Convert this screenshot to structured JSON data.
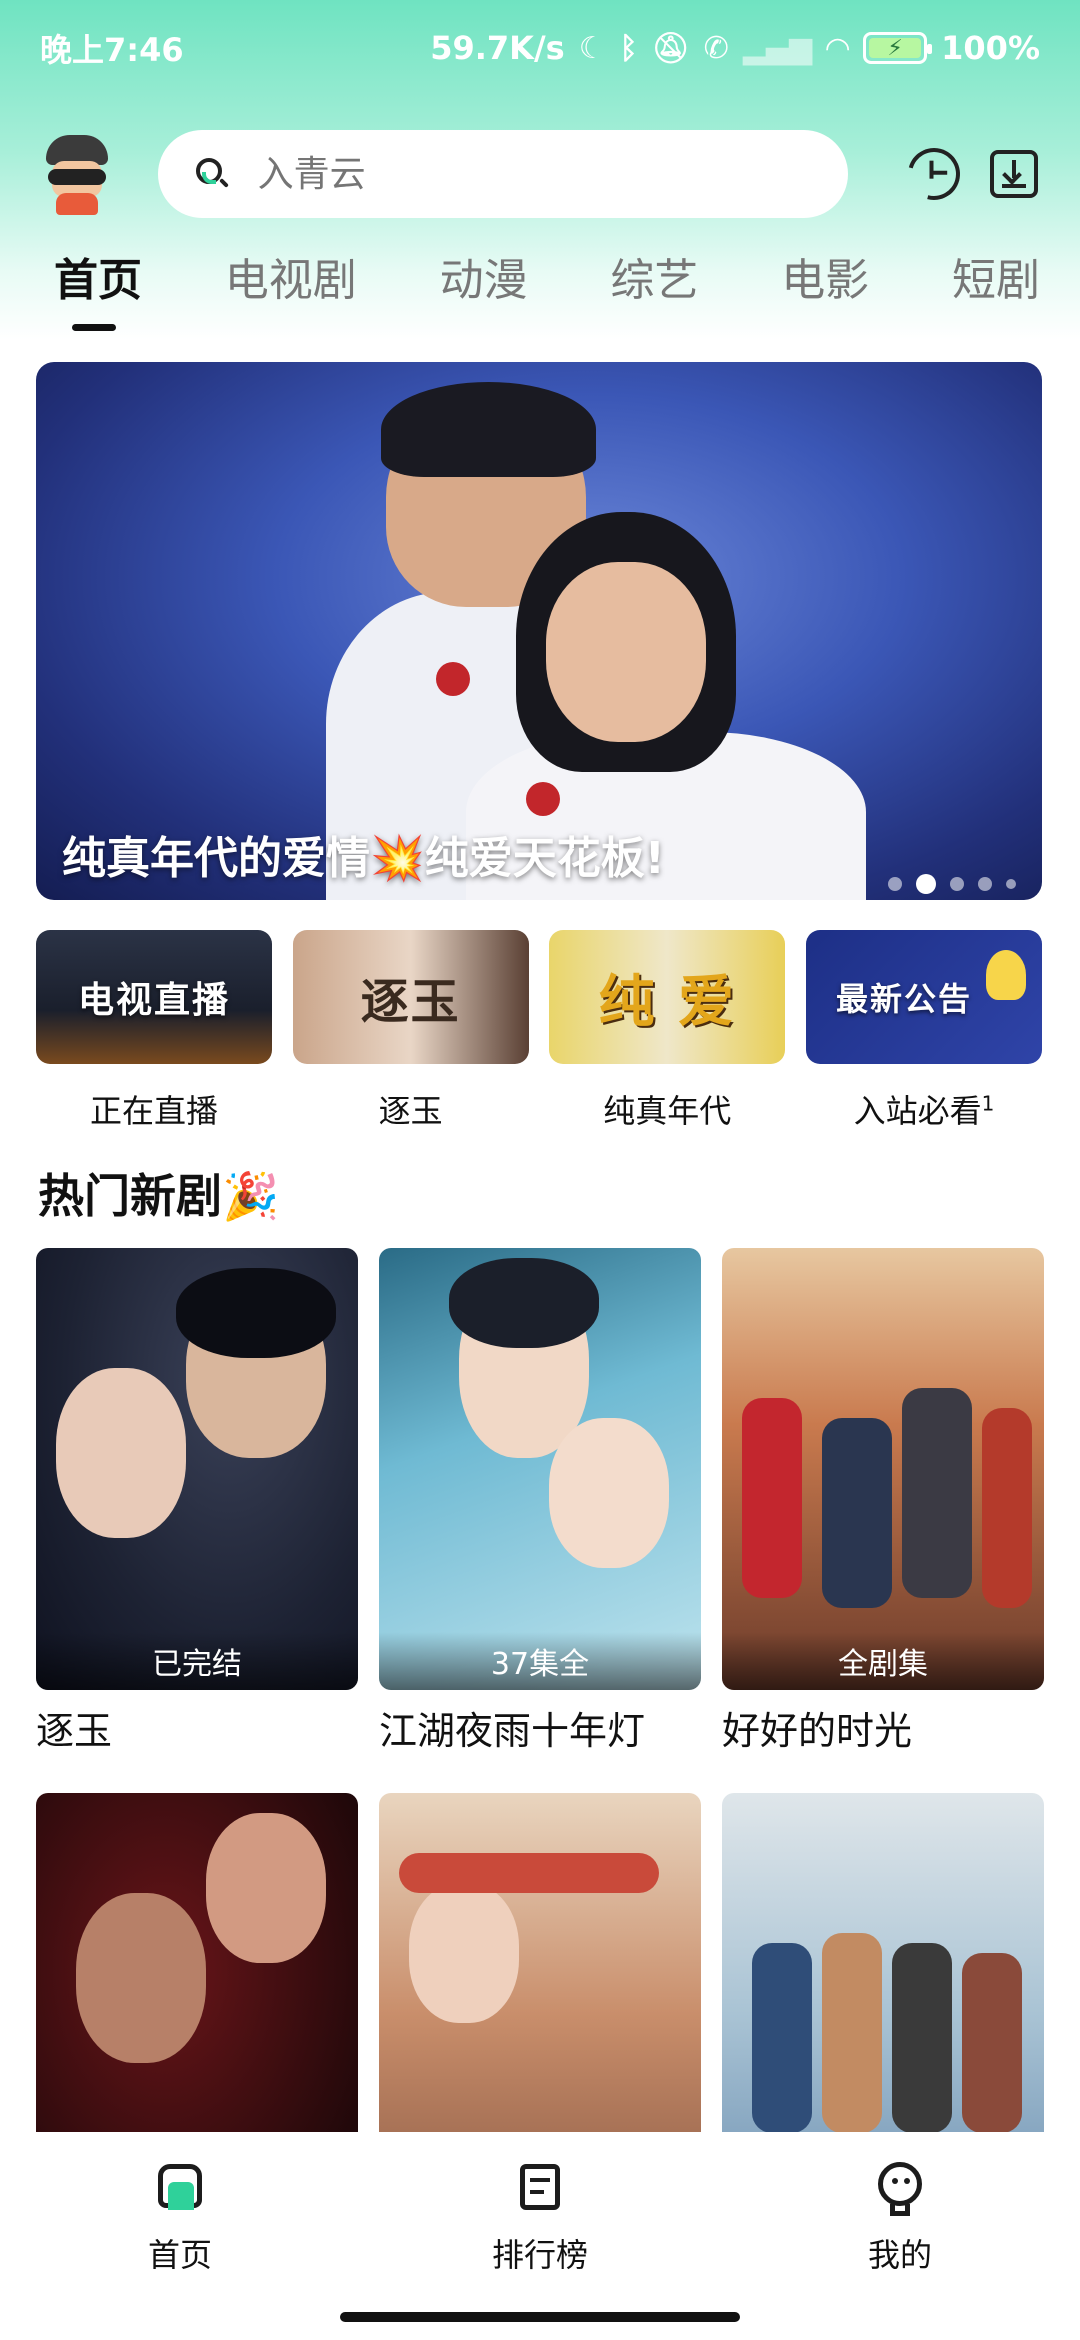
{
  "status_bar": {
    "time": "晚上7:46",
    "net_speed": "59.7K/s",
    "battery": "100%"
  },
  "search": {
    "placeholder": "入青云"
  },
  "tabs": [
    {
      "label": "首页",
      "active": true
    },
    {
      "label": "电视剧",
      "active": false
    },
    {
      "label": "动漫",
      "active": false
    },
    {
      "label": "综艺",
      "active": false
    },
    {
      "label": "电影",
      "active": false
    },
    {
      "label": "短剧",
      "active": false
    }
  ],
  "banner": {
    "caption": "纯真年代的爱情💥纯爱天花板!",
    "dot_count": 5,
    "active_dot": 1
  },
  "quick_links": [
    {
      "thumb_text": "电视直播",
      "label": "正在直播"
    },
    {
      "thumb_text": "逐玉",
      "label": "逐玉"
    },
    {
      "thumb_text": "纯 爱",
      "label": "纯真年代"
    },
    {
      "thumb_text": "最新公告",
      "label": "入站必看",
      "badge": "1"
    }
  ],
  "section": {
    "title": "热门新剧🎉"
  },
  "posters": [
    {
      "title": "逐玉",
      "badge": "已完结"
    },
    {
      "title": "江湖夜雨十年灯",
      "badge": "37集全"
    },
    {
      "title": "好好的时光",
      "badge": "全剧集"
    },
    {
      "title": "",
      "badge": ""
    },
    {
      "title": "",
      "badge": ""
    },
    {
      "title": "",
      "badge": ""
    }
  ],
  "bottom_nav": [
    {
      "label": "首页",
      "icon": "home-icon",
      "active": true
    },
    {
      "label": "排行榜",
      "icon": "rank-icon",
      "active": false
    },
    {
      "label": "我的",
      "icon": "me-icon",
      "active": false
    }
  ],
  "colors": {
    "accent": "#2fd19a",
    "gradient_top": "#6fe3c1"
  }
}
